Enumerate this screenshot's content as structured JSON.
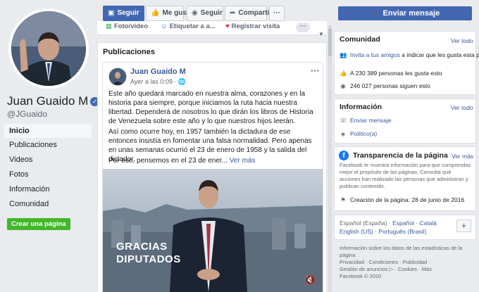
{
  "profile": {
    "name": "Juan Guaido M",
    "handle": "@JGuaido",
    "verified_glyph": "✓"
  },
  "nav": [
    {
      "label": "Inicio",
      "active": true
    },
    {
      "label": "Publicaciones"
    },
    {
      "label": "Videos"
    },
    {
      "label": "Fotos"
    },
    {
      "label": "Información"
    },
    {
      "label": "Comunidad"
    }
  ],
  "create_page_label": "Crear una página",
  "actions": {
    "follow_primary": "Seguir",
    "like": "Me gusta",
    "follow": "Seguir",
    "share": "Compartir",
    "more": "···",
    "send_message": "Enviar mensaje"
  },
  "composer": {
    "photo_video": "Foto/video",
    "tag": "Etiquetar a a...",
    "checkin": "Registrar visita",
    "more": "···"
  },
  "publications_title": "Publicaciones",
  "post": {
    "author": "Juan Guaido M",
    "time": "Ayer a las 0:09 · 🌐",
    "options": "···",
    "p1": "Este año quedará marcado en nuestra alma, corazones y en la historia para siempre, porque iniciamos la ruta hacia nuestra libertad. Dependerá de nosotros lo que dirán los libros de Historia de Venezuela sobre este año y lo que nuestros hijos leerán.",
    "p2": "Así como ocurre hoy, en 1957 también la dictadura de ese entonces insistía en fomentar una falsa normalidad. Pero apenas en unas semanas ocurrió el 23 de enero de 1958 y la salida del dictador.",
    "p3": "Por eso, pensemos en el 23 de ener...",
    "see_more": "Ver más",
    "video_overlay_line1": "GRACIAS",
    "video_overlay_line2": "DIPUTADOS"
  },
  "community": {
    "title": "Comunidad",
    "see_all": "Ver todo",
    "invite_link": "Invita a tus amigos",
    "invite_rest": " a indicar que les gusta esta página",
    "likes": "A 230 389 personas les gusta esto",
    "followers": "246 027 personas siguen esto"
  },
  "information": {
    "title": "Información",
    "see_all": "Ver todo",
    "send_message": "Enviar mensaje",
    "category": "Político(a)"
  },
  "transparency": {
    "title": "Transparencia de la página",
    "see_more": "Ver más",
    "body": "Facebook te muestra información para que comprendas mejor el propósito de las páginas. Consulta qué acciones han realizado las personas que administran y publican contenido.",
    "created": "Creación de la página: 28 de junio de 2016"
  },
  "languages": {
    "current": "Español (España)",
    "sep": " · ",
    "line1_links": [
      "Español",
      "Català"
    ],
    "line2_links": [
      "English (US)",
      "Português (Brasil)"
    ],
    "add": "+"
  },
  "footer": {
    "line1": "Información sobre los datos de las estadísticas de la página",
    "line2": "Privacidad · Condiciones · Publicidad ·",
    "line3": "Gestión de anuncios ▷ · Cookies · Más ·",
    "line4": "Facebook © 2020"
  },
  "colors": {
    "brand": "#4267b2",
    "link": "#385898",
    "green": "#42b72a",
    "bg": "#e9ebee"
  }
}
